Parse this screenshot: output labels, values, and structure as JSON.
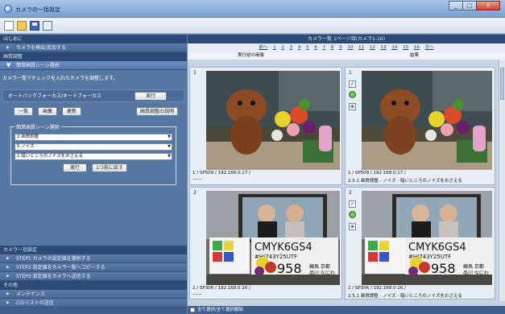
{
  "window": {
    "title": "カメラの一括設定",
    "controls": [
      "_",
      "□",
      "✕"
    ]
  },
  "toolbar": {
    "icons": [
      "new-file-icon",
      "open-folder-icon",
      "save-icon",
      "export-icon"
    ]
  },
  "left": {
    "sections": {
      "intro": "はじめに",
      "adjust": "画質調整",
      "camera_list": "カメラ一括設定",
      "other": "その他"
    },
    "nav": {
      "detect": "カメラを検出/追加する",
      "simple_scene": "簡単画質シーン選択",
      "step1": "STEP1 カメラの設定値を選択する",
      "step2": "STEP2 設定値をカメラ一覧へコピーする",
      "step3": "STEP3 設定値をカメラへ送信する",
      "maint": "メンテナンス",
      "cg": "CGIリストの送信"
    },
    "description": "カメラ一覧でチェックを入れたカメラを調整します。",
    "af_label": "オートバックフォーカス/オートフォーカス",
    "af_button": "実行",
    "list_button": "一覧",
    "image_button": "画像",
    "update_button": "更新",
    "explain_button": "画質調整の説明",
    "fieldset_legend": "簡単画質シーン選択",
    "select1": "2.画質調整",
    "select2": "5.ノイズ",
    "select3": "1.暗いところのノイズをおさえる",
    "exec_button": "実行",
    "back_button": "1つ前に戻す"
  },
  "right": {
    "title": "カメラ一覧 1ページ目(カメラ1-16)",
    "pager": [
      "前へ",
      "1",
      "2",
      "3",
      "4",
      "5",
      "6",
      "7",
      "8",
      "9",
      "10",
      "11",
      "12",
      "13",
      "14",
      "15",
      "16",
      "次へ"
    ],
    "col_before": "実行前の画像",
    "col_result": "結果",
    "cells": [
      {
        "num": "1",
        "caption": "1 / SP509 / 192.168.0.17 /",
        "sub": "------"
      },
      {
        "num": "1",
        "caption": "1 / SP509 / 192.168.0.17 /",
        "sub": "2.5.1 画質調整 - ノイズ - 暗いところのノイズをおさえる"
      },
      {
        "num": "2",
        "caption": "2 / SP306 / 192.168.0.16 /",
        "sub": "------"
      },
      {
        "num": "2",
        "caption": "2 / SP306 / 192.168.0.16 /",
        "sub": "2.5.1 画質調整 - ノイズ - 暗いところのノイズをおさえる"
      }
    ],
    "test_chart_text": [
      "CMYK6GS4",
      "#HJ743Y25UTF",
      "958",
      "練馬 京都",
      "品川 なにわ"
    ],
    "bottom_check": "全て選択/全て選択解除"
  }
}
